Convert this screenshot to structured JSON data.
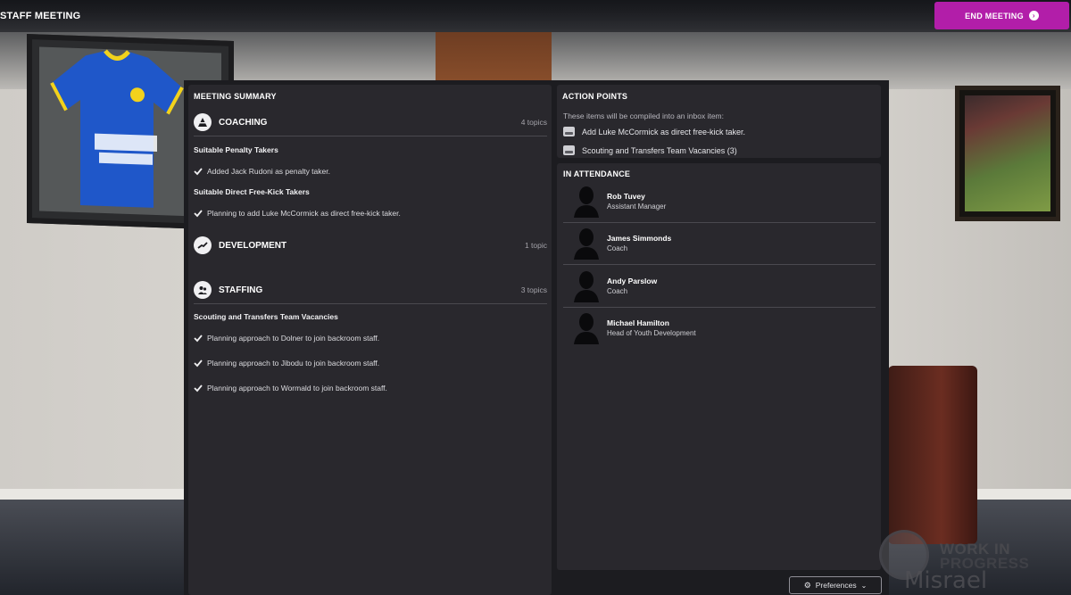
{
  "header": {
    "title": "STAFF MEETING",
    "end_button": "END MEETING"
  },
  "summary": {
    "heading": "MEETING SUMMARY",
    "categories": [
      {
        "title": "COACHING",
        "count": "4 topics",
        "icon": "coaching-cone-icon",
        "topics": [
          {
            "title": "Suitable Penalty Takers",
            "items": [
              "Added Jack Rudoni as penalty taker."
            ]
          },
          {
            "title": "Suitable Direct Free-Kick Takers",
            "items": [
              "Planning to add Luke McCormick as direct free-kick taker."
            ]
          }
        ]
      },
      {
        "title": "DEVELOPMENT",
        "count": "1 topic",
        "icon": "development-icon",
        "topics": []
      },
      {
        "title": "STAFFING",
        "count": "3 topics",
        "icon": "staffing-icon",
        "topics": [
          {
            "title": "Scouting and Transfers Team Vacancies",
            "items": [
              "Planning approach to Dolner to join backroom staff.",
              "Planning approach to Jibodu to join backroom staff.",
              "Planning approach to Wormald to join backroom staff."
            ]
          }
        ]
      }
    ]
  },
  "action_points": {
    "heading": "ACTION POINTS",
    "note": "These items will be compiled into an inbox item:",
    "items": [
      "Add Luke McCormick as direct free-kick taker.",
      "Scouting and Transfers Team Vacancies (3)"
    ]
  },
  "attendance": {
    "heading": "IN ATTENDANCE",
    "people": [
      {
        "name": "Rob Tuvey",
        "role": "Assistant Manager"
      },
      {
        "name": "James Simmonds",
        "role": "Coach"
      },
      {
        "name": "Andy Parslow",
        "role": "Coach"
      },
      {
        "name": "Michael Hamilton",
        "role": "Head of Youth Development"
      }
    ]
  },
  "footer": {
    "preferences": "Preferences"
  },
  "watermark": {
    "line1": "WORK IN",
    "line2": "PROGRESS",
    "line3": "Misrael"
  },
  "colors": {
    "accent": "#b21ea9",
    "panel": "#29282d",
    "background": "#1c1c20"
  }
}
